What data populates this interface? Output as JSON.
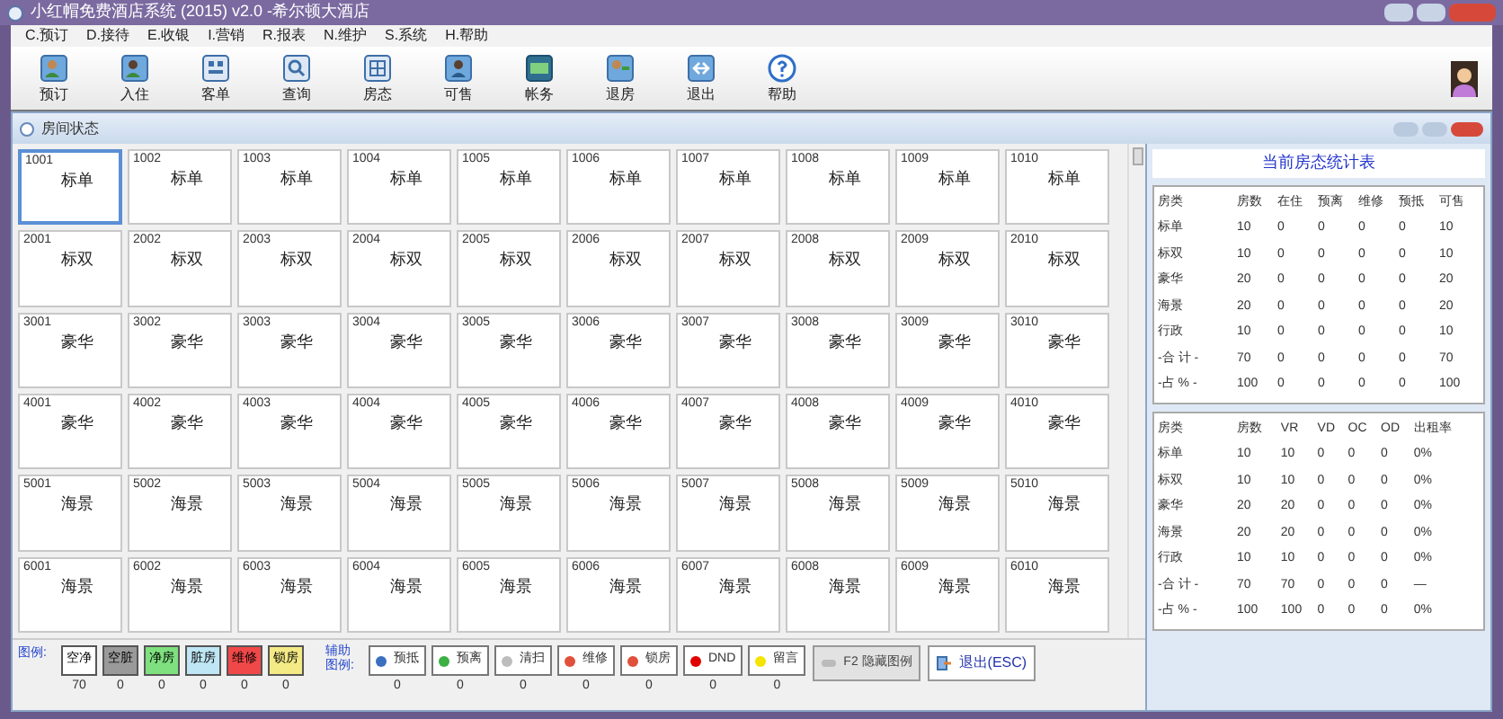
{
  "window": {
    "title": "小红帽免费酒店系统 (2015) v2.0 -希尔顿大酒店"
  },
  "menu": [
    "C.预订",
    "D.接待",
    "E.收银",
    "I.营销",
    "R.报表",
    "N.维护",
    "S.系统",
    "H.帮助"
  ],
  "toolbar": [
    "预订",
    "入住",
    "客单",
    "查询",
    "房态",
    "可售",
    "帐务",
    "退房",
    "退出",
    "帮助"
  ],
  "room_window": {
    "title": "房间状态"
  },
  "floors": [
    {
      "rooms": [
        {
          "number": "1001",
          "type": "标单",
          "selected": true
        },
        {
          "number": "1002",
          "type": "标单",
          "selected": false
        },
        {
          "number": "1003",
          "type": "标单",
          "selected": false
        },
        {
          "number": "1004",
          "type": "标单",
          "selected": false
        },
        {
          "number": "1005",
          "type": "标单",
          "selected": false
        },
        {
          "number": "1006",
          "type": "标单",
          "selected": false
        },
        {
          "number": "1007",
          "type": "标单",
          "selected": false
        },
        {
          "number": "1008",
          "type": "标单",
          "selected": false
        },
        {
          "number": "1009",
          "type": "标单",
          "selected": false
        },
        {
          "number": "1010",
          "type": "标单",
          "selected": false
        }
      ]
    },
    {
      "rooms": [
        {
          "number": "2001",
          "type": "标双",
          "selected": false
        },
        {
          "number": "2002",
          "type": "标双",
          "selected": false
        },
        {
          "number": "2003",
          "type": "标双",
          "selected": false
        },
        {
          "number": "2004",
          "type": "标双",
          "selected": false
        },
        {
          "number": "2005",
          "type": "标双",
          "selected": false
        },
        {
          "number": "2006",
          "type": "标双",
          "selected": false
        },
        {
          "number": "2007",
          "type": "标双",
          "selected": false
        },
        {
          "number": "2008",
          "type": "标双",
          "selected": false
        },
        {
          "number": "2009",
          "type": "标双",
          "selected": false
        },
        {
          "number": "2010",
          "type": "标双",
          "selected": false
        }
      ]
    },
    {
      "rooms": [
        {
          "number": "3001",
          "type": "豪华",
          "selected": false
        },
        {
          "number": "3002",
          "type": "豪华",
          "selected": false
        },
        {
          "number": "3003",
          "type": "豪华",
          "selected": false
        },
        {
          "number": "3004",
          "type": "豪华",
          "selected": false
        },
        {
          "number": "3005",
          "type": "豪华",
          "selected": false
        },
        {
          "number": "3006",
          "type": "豪华",
          "selected": false
        },
        {
          "number": "3007",
          "type": "豪华",
          "selected": false
        },
        {
          "number": "3008",
          "type": "豪华",
          "selected": false
        },
        {
          "number": "3009",
          "type": "豪华",
          "selected": false
        },
        {
          "number": "3010",
          "type": "豪华",
          "selected": false
        }
      ]
    },
    {
      "rooms": [
        {
          "number": "4001",
          "type": "豪华",
          "selected": false
        },
        {
          "number": "4002",
          "type": "豪华",
          "selected": false
        },
        {
          "number": "4003",
          "type": "豪华",
          "selected": false
        },
        {
          "number": "4004",
          "type": "豪华",
          "selected": false
        },
        {
          "number": "4005",
          "type": "豪华",
          "selected": false
        },
        {
          "number": "4006",
          "type": "豪华",
          "selected": false
        },
        {
          "number": "4007",
          "type": "豪华",
          "selected": false
        },
        {
          "number": "4008",
          "type": "豪华",
          "selected": false
        },
        {
          "number": "4009",
          "type": "豪华",
          "selected": false
        },
        {
          "number": "4010",
          "type": "豪华",
          "selected": false
        }
      ]
    },
    {
      "rooms": [
        {
          "number": "5001",
          "type": "海景",
          "selected": false
        },
        {
          "number": "5002",
          "type": "海景",
          "selected": false
        },
        {
          "number": "5003",
          "type": "海景",
          "selected": false
        },
        {
          "number": "5004",
          "type": "海景",
          "selected": false
        },
        {
          "number": "5005",
          "type": "海景",
          "selected": false
        },
        {
          "number": "5006",
          "type": "海景",
          "selected": false
        },
        {
          "number": "5007",
          "type": "海景",
          "selected": false
        },
        {
          "number": "5008",
          "type": "海景",
          "selected": false
        },
        {
          "number": "5009",
          "type": "海景",
          "selected": false
        },
        {
          "number": "5010",
          "type": "海景",
          "selected": false
        }
      ]
    },
    {
      "rooms": [
        {
          "number": "6001",
          "type": "海景",
          "selected": false
        },
        {
          "number": "6002",
          "type": "海景",
          "selected": false
        },
        {
          "number": "6003",
          "type": "海景",
          "selected": false
        },
        {
          "number": "6004",
          "type": "海景",
          "selected": false
        },
        {
          "number": "6005",
          "type": "海景",
          "selected": false
        },
        {
          "number": "6006",
          "type": "海景",
          "selected": false
        },
        {
          "number": "6007",
          "type": "海景",
          "selected": false
        },
        {
          "number": "6008",
          "type": "海景",
          "selected": false
        },
        {
          "number": "6009",
          "type": "海景",
          "selected": false
        },
        {
          "number": "6010",
          "type": "海景",
          "selected": false
        }
      ]
    }
  ],
  "legend": {
    "label": "图例:",
    "items": [
      {
        "label": "空净",
        "count": "70",
        "color": "#ffffff"
      },
      {
        "label": "空脏",
        "count": "0",
        "color": "#9a9a9a"
      },
      {
        "label": "净房",
        "count": "0",
        "color": "#7ee07e"
      },
      {
        "label": "脏房",
        "count": "0",
        "color": "#bfe6f5"
      },
      {
        "label": "维修",
        "count": "0",
        "color": "#f04848"
      },
      {
        "label": "锁房",
        "count": "0",
        "color": "#f3ea86"
      }
    ]
  },
  "aux_legend": {
    "label": "辅助图例:",
    "items": [
      {
        "label": "预抵",
        "count": "0",
        "color": "#3b6fc0"
      },
      {
        "label": "预离",
        "count": "0",
        "color": "#3cb043"
      },
      {
        "label": "清扫",
        "count": "0",
        "color": "#bdbdbd"
      },
      {
        "label": "维修",
        "count": "0",
        "color": "#e0503a"
      },
      {
        "label": "锁房",
        "count": "0",
        "color": "#e0503a"
      },
      {
        "label": "DND",
        "count": "0",
        "color": "#e00000"
      },
      {
        "label": "留言",
        "count": "0",
        "color": "#f5e400"
      }
    ]
  },
  "hide_legend_button": "F2 隐藏图例",
  "exit_button": "退出(ESC)",
  "stats": {
    "title": "当前房态统计表",
    "table_1": {
      "columns": [
        "房类",
        "房数",
        "在住",
        "预离",
        "维修",
        "预抵",
        "可售"
      ],
      "rows": [
        [
          "标单",
          "10",
          "0",
          "0",
          "0",
          "0",
          "10"
        ],
        [
          "标双",
          "10",
          "0",
          "0",
          "0",
          "0",
          "10"
        ],
        [
          "豪华",
          "20",
          "0",
          "0",
          "0",
          "0",
          "20"
        ],
        [
          "海景",
          "20",
          "0",
          "0",
          "0",
          "0",
          "20"
        ],
        [
          "行政",
          "10",
          "0",
          "0",
          "0",
          "0",
          "10"
        ],
        [
          "-合 计 -",
          "70",
          "0",
          "0",
          "0",
          "0",
          "70"
        ],
        [
          "-占 % -",
          "100",
          "0",
          "0",
          "0",
          "0",
          "100"
        ]
      ]
    },
    "table_2": {
      "columns": [
        "房类",
        "房数",
        "VR",
        "VD",
        "OC",
        "OD",
        "出租率"
      ],
      "rows": [
        [
          "标单",
          "10",
          "10",
          "0",
          "0",
          "0",
          "0%"
        ],
        [
          "标双",
          "10",
          "10",
          "0",
          "0",
          "0",
          "0%"
        ],
        [
          "豪华",
          "20",
          "20",
          "0",
          "0",
          "0",
          "0%"
        ],
        [
          "海景",
          "20",
          "20",
          "0",
          "0",
          "0",
          "0%"
        ],
        [
          "行政",
          "10",
          "10",
          "0",
          "0",
          "0",
          "0%"
        ],
        [
          "-合 计 -",
          "70",
          "70",
          "0",
          "0",
          "0",
          "—"
        ],
        [
          "-占 % -",
          "100",
          "100",
          "0",
          "0",
          "0",
          "0%"
        ]
      ]
    }
  }
}
